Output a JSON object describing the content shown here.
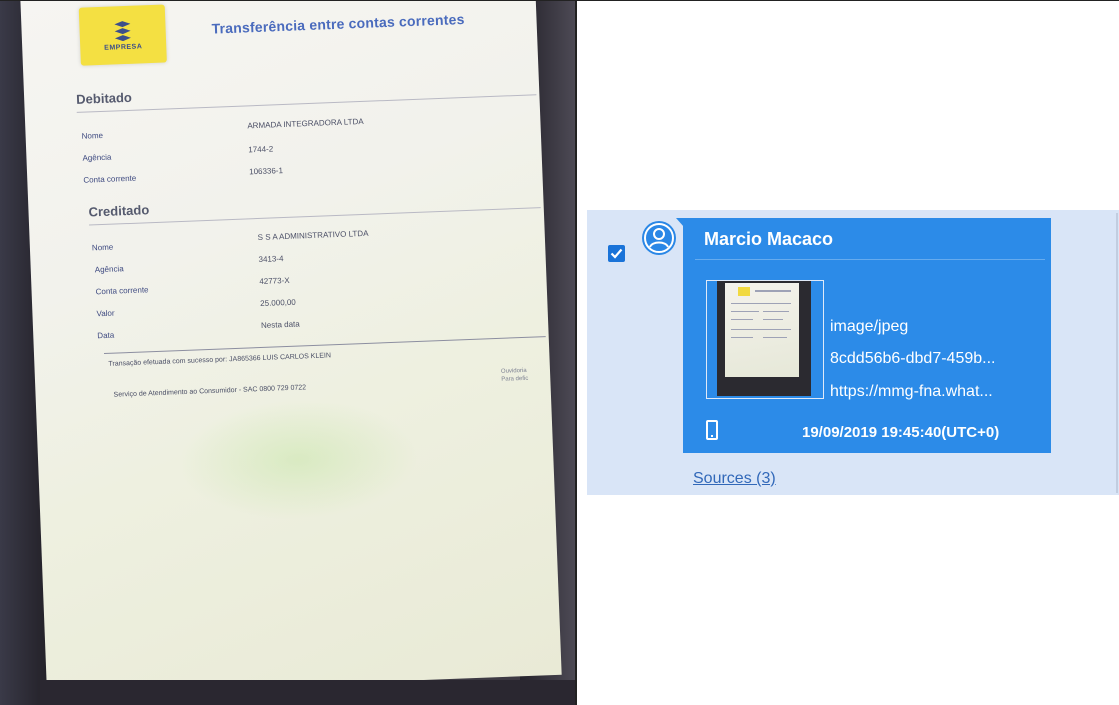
{
  "receipt": {
    "bank_tag": "EMPRESA",
    "title": "Transferência entre contas correntes",
    "debit": {
      "heading": "Debitado",
      "rows": [
        {
          "label": "Nome",
          "value": "ARMADA INTEGRADORA LTDA"
        },
        {
          "label": "Agência",
          "value": "1744-2"
        },
        {
          "label": "Conta corrente",
          "value": "106336-1"
        }
      ]
    },
    "credit": {
      "heading": "Creditado",
      "rows": [
        {
          "label": "Nome",
          "value": "S S A ADMINISTRATIVO LTDA"
        },
        {
          "label": "Agência",
          "value": "3413-4"
        },
        {
          "label": "Conta corrente",
          "value": "42773-X"
        },
        {
          "label": "Valor",
          "value": "25.000,00"
        },
        {
          "label": "Data",
          "value": "Nesta data"
        }
      ]
    },
    "confirmation": "Transação efetuada com sucesso por: JA865366 LUIS CARLOS KLEIN",
    "sac": "Serviço de Atendimento ao Consumidor - SAC 0800 729 0722",
    "edge_text_1": "Ouvidoria",
    "edge_text_2": "Para defic"
  },
  "message": {
    "checked": true,
    "sender": "Marcio Macaco",
    "attachment": {
      "mime": "image/jpeg",
      "id": "8cdd56b6-dbd7-459b...",
      "url": "https://mmg-fna.what..."
    },
    "timestamp": "19/09/2019 19:45:40(UTC+0)",
    "sources_link": "Sources (3)",
    "colors": {
      "bubble": "#2c8be8",
      "panel": "#d9e5f7",
      "checkbox": "#1a73d8",
      "link": "#3168b9"
    },
    "icons": [
      "user-icon",
      "checkmark-icon",
      "smartphone-icon"
    ]
  }
}
